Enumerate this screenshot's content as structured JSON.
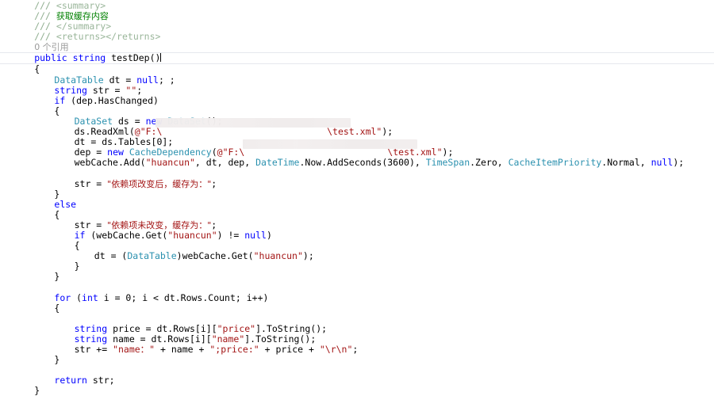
{
  "editor": {
    "app": "code-editor",
    "language": "csharp",
    "colors": {
      "background": "#ffffff",
      "keyword": "#0000ff",
      "type": "#2b91af",
      "string": "#a31515",
      "comment": "#008000",
      "codelens": "#9a9a9a",
      "current_line_border": "#e6e8ed"
    },
    "codelens": {
      "references": "0 个引用"
    },
    "redactions": [
      {
        "name": "file-path-redaction-1",
        "note": "covers file path in ds.ReadXml argument"
      },
      {
        "name": "file-path-redaction-2",
        "note": "covers file path in CacheDependency argument"
      }
    ],
    "lines": [
      {
        "id": "l1",
        "indent": 2,
        "tokens": [
          {
            "t": "/// ",
            "c": "cmt-dim"
          },
          {
            "t": "<summary>",
            "c": "xmltag"
          }
        ]
      },
      {
        "id": "l2",
        "indent": 2,
        "tokens": [
          {
            "t": "/// ",
            "c": "cmt-dim"
          },
          {
            "t": "获取缓存内容",
            "c": "cmt",
            "cjk": true
          }
        ]
      },
      {
        "id": "l3",
        "indent": 2,
        "tokens": [
          {
            "t": "/// ",
            "c": "cmt-dim"
          },
          {
            "t": "</summary>",
            "c": "xmltag"
          }
        ]
      },
      {
        "id": "l4",
        "indent": 2,
        "tokens": [
          {
            "t": "/// ",
            "c": "cmt-dim"
          },
          {
            "t": "<returns></returns>",
            "c": "xmltag"
          }
        ]
      },
      {
        "id": "l5",
        "indent": 2,
        "codelens": true,
        "tokens": [
          {
            "t": "0 个引用",
            "c": "codelens",
            "cjk": true
          }
        ]
      },
      {
        "id": "l6",
        "indent": 2,
        "current": true,
        "tokens": [
          {
            "t": "public",
            "c": "kw"
          },
          {
            "t": " "
          },
          {
            "t": "string",
            "c": "kw"
          },
          {
            "t": " testDep()"
          },
          {
            "t": "",
            "c": "caret"
          }
        ]
      },
      {
        "id": "l7",
        "indent": 2,
        "tokens": [
          {
            "t": "{"
          }
        ]
      },
      {
        "id": "l8",
        "indent": 4,
        "tokens": [
          {
            "t": "DataTable",
            "c": "type"
          },
          {
            "t": " dt = "
          },
          {
            "t": "null",
            "c": "kw"
          },
          {
            "t": "; ;"
          }
        ]
      },
      {
        "id": "l9",
        "indent": 4,
        "tokens": [
          {
            "t": "string",
            "c": "kw"
          },
          {
            "t": " str = "
          },
          {
            "t": "\"\"",
            "c": "str"
          },
          {
            "t": ";"
          }
        ]
      },
      {
        "id": "l10",
        "indent": 4,
        "tokens": [
          {
            "t": "if",
            "c": "kw"
          },
          {
            "t": " (dep.HasChanged)"
          }
        ]
      },
      {
        "id": "l11",
        "indent": 4,
        "tokens": [
          {
            "t": "{"
          }
        ]
      },
      {
        "id": "l12",
        "indent": 6,
        "tokens": [
          {
            "t": "DataSet",
            "c": "type"
          },
          {
            "t": " ds = "
          },
          {
            "t": "new",
            "c": "kw"
          },
          {
            "t": " "
          },
          {
            "t": "DataSet",
            "c": "type"
          },
          {
            "t": "();"
          }
        ]
      },
      {
        "id": "l13",
        "indent": 6,
        "tokens": [
          {
            "t": "ds.ReadXml("
          },
          {
            "t": "@\"F:\\",
            "c": "str"
          },
          {
            "t": "                              ",
            "c": "str"
          },
          {
            "t": "\\test.xml\"",
            "c": "str"
          },
          {
            "t": ");"
          }
        ]
      },
      {
        "id": "l14",
        "indent": 6,
        "tokens": [
          {
            "t": "dt = ds.Tables[0];"
          }
        ]
      },
      {
        "id": "l15",
        "indent": 6,
        "tokens": [
          {
            "t": "dep = "
          },
          {
            "t": "new",
            "c": "kw"
          },
          {
            "t": " "
          },
          {
            "t": "CacheDependency",
            "c": "type"
          },
          {
            "t": "("
          },
          {
            "t": "@\"F:\\",
            "c": "str"
          },
          {
            "t": "                          ",
            "c": "str"
          },
          {
            "t": "\\test.xml\"",
            "c": "str"
          },
          {
            "t": ");"
          }
        ]
      },
      {
        "id": "l16",
        "indent": 6,
        "tokens": [
          {
            "t": "webCache.Add("
          },
          {
            "t": "\"huancun\"",
            "c": "str"
          },
          {
            "t": ", dt, dep, "
          },
          {
            "t": "DateTime",
            "c": "type"
          },
          {
            "t": ".Now.AddSeconds(3600), "
          },
          {
            "t": "TimeSpan",
            "c": "type"
          },
          {
            "t": ".Zero, "
          },
          {
            "t": "CacheItemPriority",
            "c": "type"
          },
          {
            "t": ".Normal, "
          },
          {
            "t": "null",
            "c": "kw"
          },
          {
            "t": ");"
          }
        ]
      },
      {
        "id": "l17",
        "indent": 0,
        "tokens": [
          {
            "t": ""
          }
        ]
      },
      {
        "id": "l18",
        "indent": 6,
        "tokens": [
          {
            "t": "str = "
          },
          {
            "t": "\"依赖项改变后，缓存为：\"",
            "c": "str",
            "cjk": true
          },
          {
            "t": ";"
          }
        ]
      },
      {
        "id": "l19",
        "indent": 4,
        "tokens": [
          {
            "t": "}"
          }
        ]
      },
      {
        "id": "l20",
        "indent": 4,
        "tokens": [
          {
            "t": "else",
            "c": "kw"
          }
        ]
      },
      {
        "id": "l21",
        "indent": 4,
        "tokens": [
          {
            "t": "{"
          }
        ]
      },
      {
        "id": "l22",
        "indent": 6,
        "tokens": [
          {
            "t": "str = "
          },
          {
            "t": "\"依赖项未改变，缓存为：\"",
            "c": "str",
            "cjk": true
          },
          {
            "t": ";"
          }
        ]
      },
      {
        "id": "l23",
        "indent": 6,
        "tokens": [
          {
            "t": "if",
            "c": "kw"
          },
          {
            "t": " (webCache.Get("
          },
          {
            "t": "\"huancun\"",
            "c": "str"
          },
          {
            "t": ") != "
          },
          {
            "t": "null",
            "c": "kw"
          },
          {
            "t": ")"
          }
        ]
      },
      {
        "id": "l24",
        "indent": 6,
        "tokens": [
          {
            "t": "{"
          }
        ]
      },
      {
        "id": "l25",
        "indent": 8,
        "tokens": [
          {
            "t": "dt = ("
          },
          {
            "t": "DataTable",
            "c": "type"
          },
          {
            "t": ")webCache.Get("
          },
          {
            "t": "\"huancun\"",
            "c": "str"
          },
          {
            "t": ");"
          }
        ]
      },
      {
        "id": "l26",
        "indent": 6,
        "tokens": [
          {
            "t": "}"
          }
        ]
      },
      {
        "id": "l27",
        "indent": 4,
        "tokens": [
          {
            "t": "}"
          }
        ]
      },
      {
        "id": "l28",
        "indent": 0,
        "tokens": [
          {
            "t": ""
          }
        ]
      },
      {
        "id": "l29",
        "indent": 4,
        "tokens": [
          {
            "t": "for",
            "c": "kw"
          },
          {
            "t": " ("
          },
          {
            "t": "int",
            "c": "kw"
          },
          {
            "t": " i = 0; i < dt.Rows.Count; i++)"
          }
        ]
      },
      {
        "id": "l30",
        "indent": 4,
        "tokens": [
          {
            "t": "{"
          }
        ]
      },
      {
        "id": "l31",
        "indent": 0,
        "tokens": [
          {
            "t": ""
          }
        ]
      },
      {
        "id": "l32",
        "indent": 6,
        "tokens": [
          {
            "t": "string",
            "c": "kw"
          },
          {
            "t": " price = dt.Rows[i]["
          },
          {
            "t": "\"price\"",
            "c": "str"
          },
          {
            "t": "].ToString();"
          }
        ]
      },
      {
        "id": "l33",
        "indent": 6,
        "tokens": [
          {
            "t": "string",
            "c": "kw"
          },
          {
            "t": " name = dt.Rows[i]["
          },
          {
            "t": "\"name\"",
            "c": "str"
          },
          {
            "t": "].ToString();"
          }
        ]
      },
      {
        "id": "l34",
        "indent": 6,
        "tokens": [
          {
            "t": "str += "
          },
          {
            "t": "\"name：\"",
            "c": "str"
          },
          {
            "t": " + name + "
          },
          {
            "t": "\";price:\"",
            "c": "str"
          },
          {
            "t": " + price + "
          },
          {
            "t": "\"\\r\\n\"",
            "c": "str"
          },
          {
            "t": ";"
          }
        ]
      },
      {
        "id": "l35",
        "indent": 4,
        "tokens": [
          {
            "t": "}"
          }
        ]
      },
      {
        "id": "l36",
        "indent": 0,
        "tokens": [
          {
            "t": ""
          }
        ]
      },
      {
        "id": "l37",
        "indent": 4,
        "tokens": [
          {
            "t": "return",
            "c": "kw"
          },
          {
            "t": " str;"
          }
        ]
      },
      {
        "id": "l38",
        "indent": 2,
        "tokens": [
          {
            "t": "}"
          }
        ]
      }
    ]
  }
}
